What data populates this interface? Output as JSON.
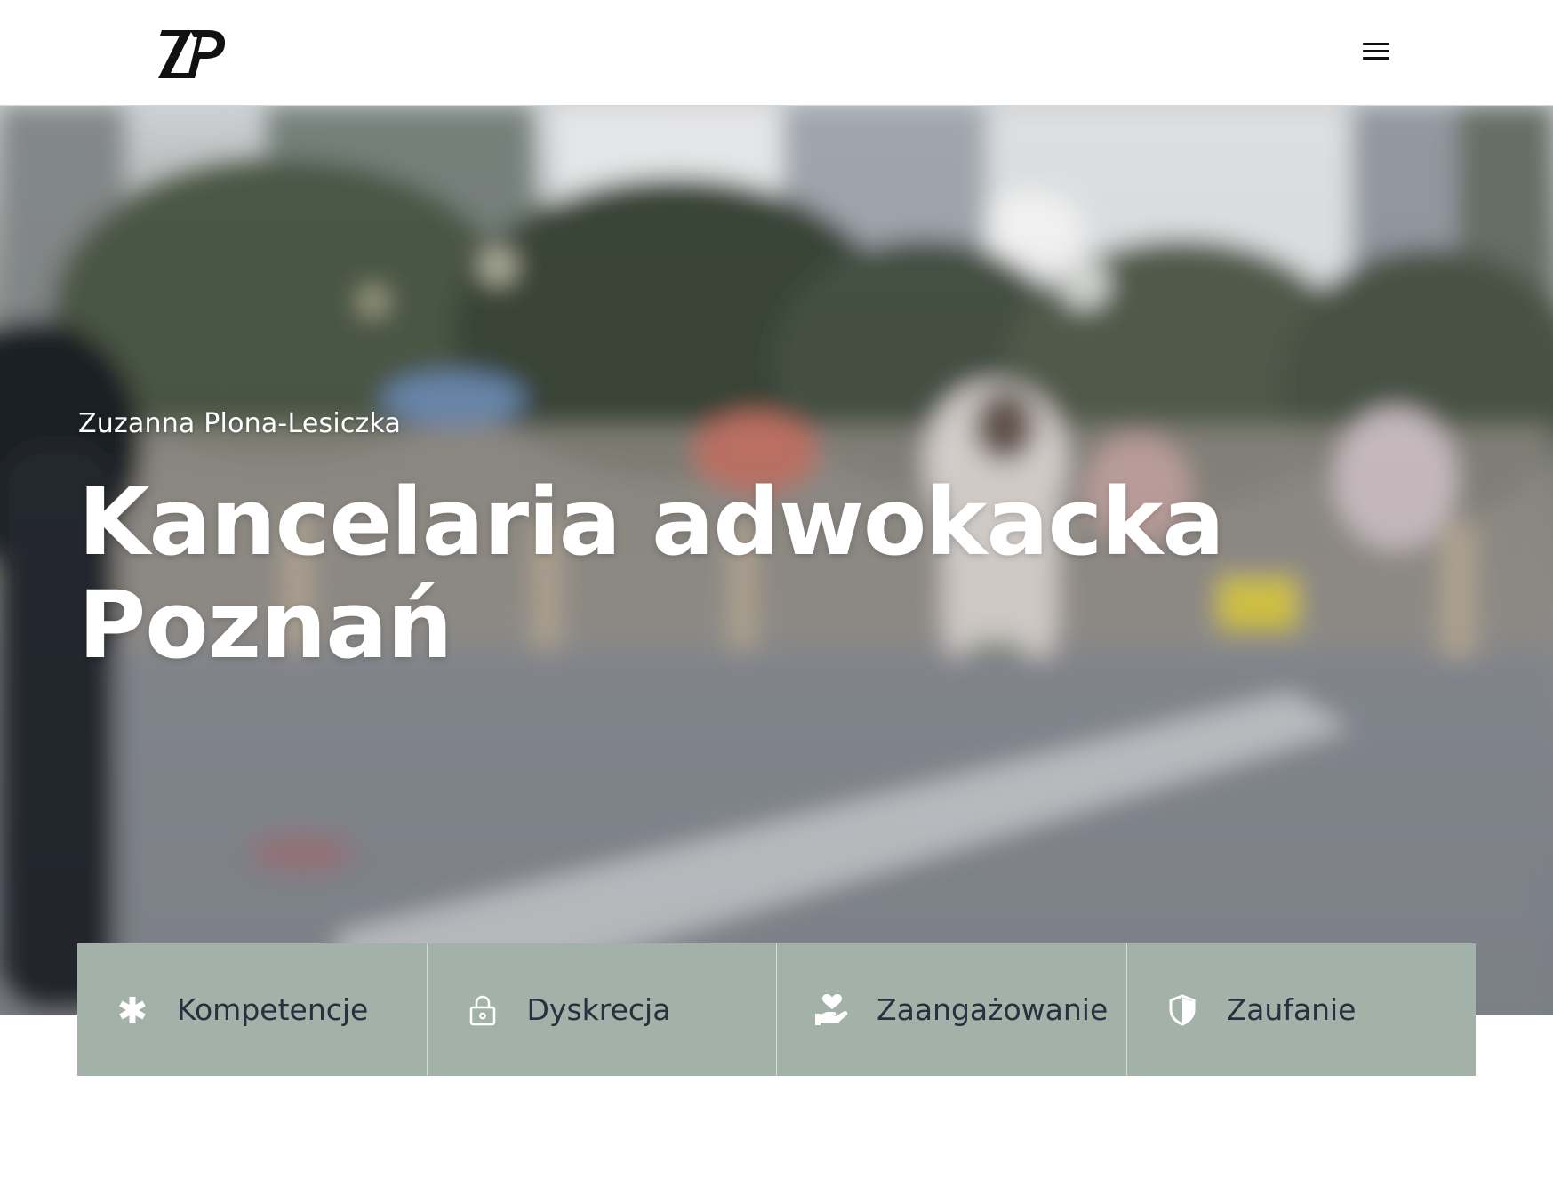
{
  "header": {
    "logo_text": "ZP",
    "menu_icon": "hamburger-menu-icon"
  },
  "hero": {
    "subtitle": "Zuzanna Plona-Lesiczka",
    "title_line1": "Kancelaria adwokacka",
    "title_line2": "Poznań"
  },
  "features": [
    {
      "icon": "asterisk-icon",
      "label": "Kompetencje"
    },
    {
      "icon": "lock-icon",
      "label": "Dyskrecja"
    },
    {
      "icon": "hand-heart-icon",
      "label": "Zaangażowanie"
    },
    {
      "icon": "shield-icon",
      "label": "Zaufanie"
    }
  ],
  "colors": {
    "feature_bg": "#a3b2a8",
    "feature_text": "#26303f",
    "hero_text": "#ffffff"
  }
}
